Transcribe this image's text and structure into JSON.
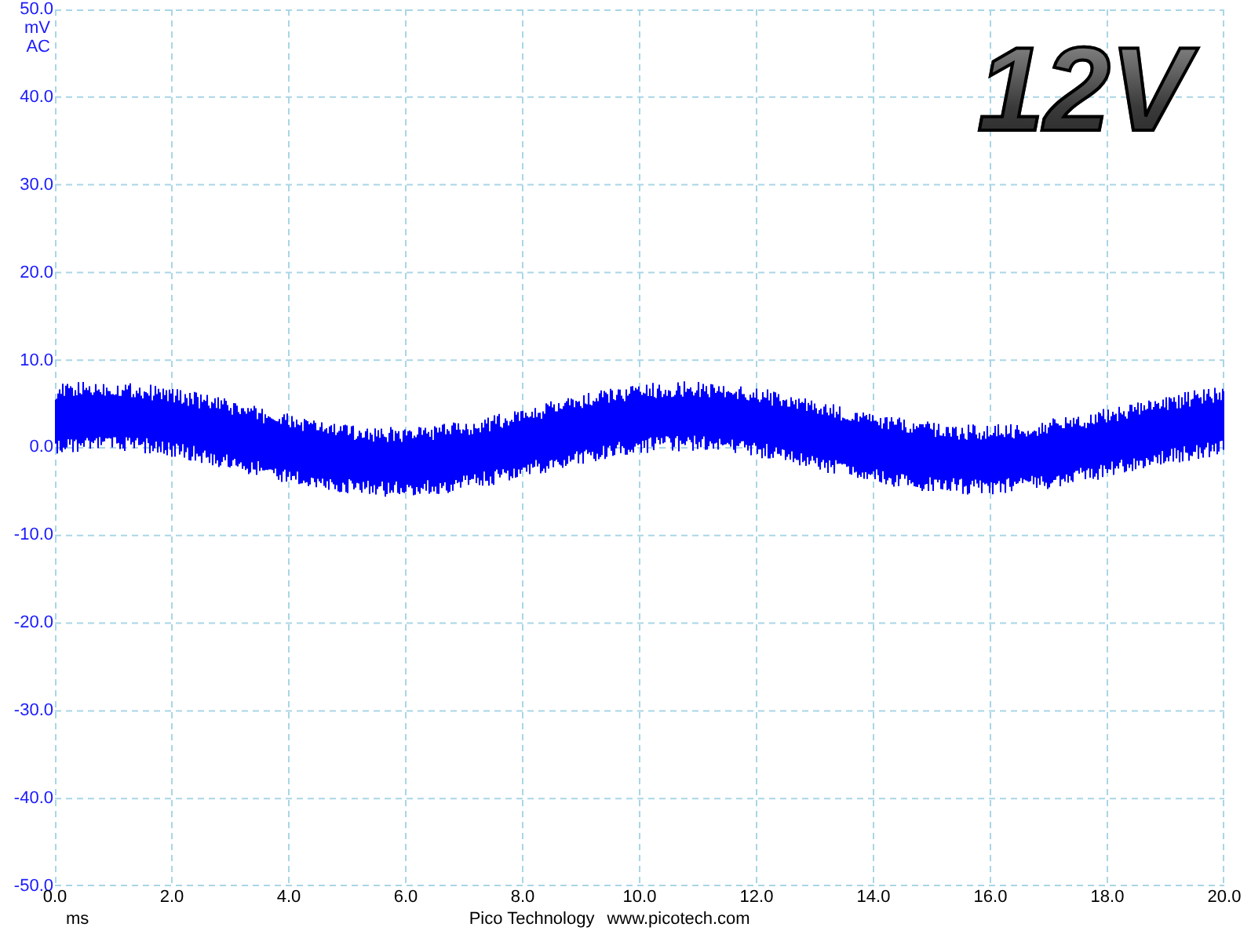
{
  "scope": {
    "y_unit": "mV",
    "coupling": "AC",
    "range_label": "12V",
    "y_ticks": [
      "50.0",
      "40.0",
      "30.0",
      "20.0",
      "10.0",
      "0.0",
      "-10.0",
      "-20.0",
      "-30.0",
      "-40.0",
      "-50.0"
    ],
    "x_ticks": [
      "0.0",
      "2.0",
      "4.0",
      "6.0",
      "8.0",
      "10.0",
      "12.0",
      "14.0",
      "16.0",
      "18.0",
      "20.0"
    ],
    "x_unit": "ms"
  },
  "footer": {
    "brand": "Pico Technology",
    "url": "www.picotech.com"
  }
}
